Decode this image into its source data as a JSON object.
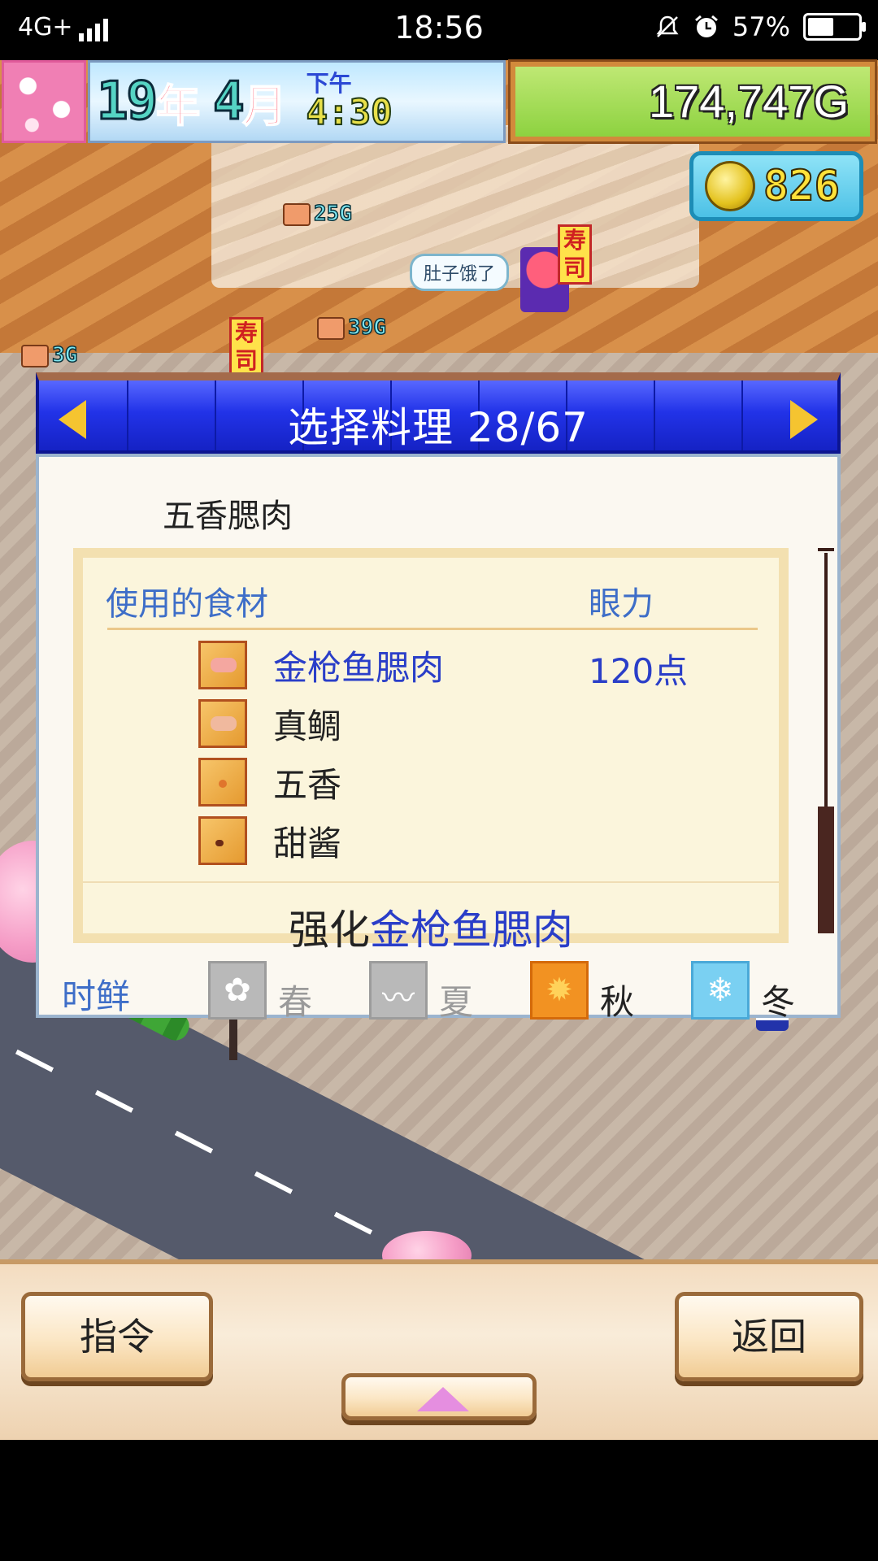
{
  "status_bar": {
    "network": "4G+",
    "time": "18:56",
    "battery": "57%",
    "battery_level": 0.57,
    "icons": [
      "signal-icon",
      "mute-icon",
      "alarm-icon",
      "battery-icon"
    ]
  },
  "hud": {
    "year_num": "19",
    "year_label": "年",
    "month_num": "4",
    "month_label": "月",
    "ampm": "下午",
    "clock": "4:30",
    "money": "174,747G",
    "medals": "826"
  },
  "scene": {
    "speech_bubble": "肚子饿了",
    "price_tags": [
      "25G",
      "39G",
      "3G"
    ],
    "signs": [
      "寿司",
      "寿司"
    ]
  },
  "dialog": {
    "title": "选择料理 28/67",
    "dish_name": "五香腮肉",
    "ingredients_header": "使用的食材",
    "eye_header": "眼力",
    "ingredients": [
      {
        "name": "金枪鱼腮肉",
        "icon": "tuna-cheek-icon",
        "highlight": true
      },
      {
        "name": "真鲷",
        "icon": "sea-bream-icon",
        "highlight": false
      },
      {
        "name": "五香",
        "icon": "five-spice-icon",
        "highlight": false
      },
      {
        "name": "甜酱",
        "icon": "sweet-sauce-icon",
        "highlight": false
      }
    ],
    "eye_value": "120点",
    "enhance_prefix": "强化",
    "enhance_target": "金枪鱼腮肉",
    "season_label": "时鲜",
    "seasons": [
      {
        "name": "春",
        "active": false,
        "icon": "sakura-icon"
      },
      {
        "name": "夏",
        "active": false,
        "icon": "wave-icon"
      },
      {
        "name": "秋",
        "active": true,
        "icon": "maple-leaf-icon"
      },
      {
        "name": "冬",
        "active": true,
        "icon": "snowflake-icon"
      }
    ]
  },
  "bottom_bar": {
    "command_label": "指令",
    "back_label": "返回",
    "up_icon": "up-triangle-icon"
  },
  "colors": {
    "header_blue": "#2233e8",
    "highlight_blue": "#2a3ec8",
    "label_blue": "#3e6ec8",
    "arrow_gold": "#f5c430",
    "money_green": "#8dd240"
  }
}
